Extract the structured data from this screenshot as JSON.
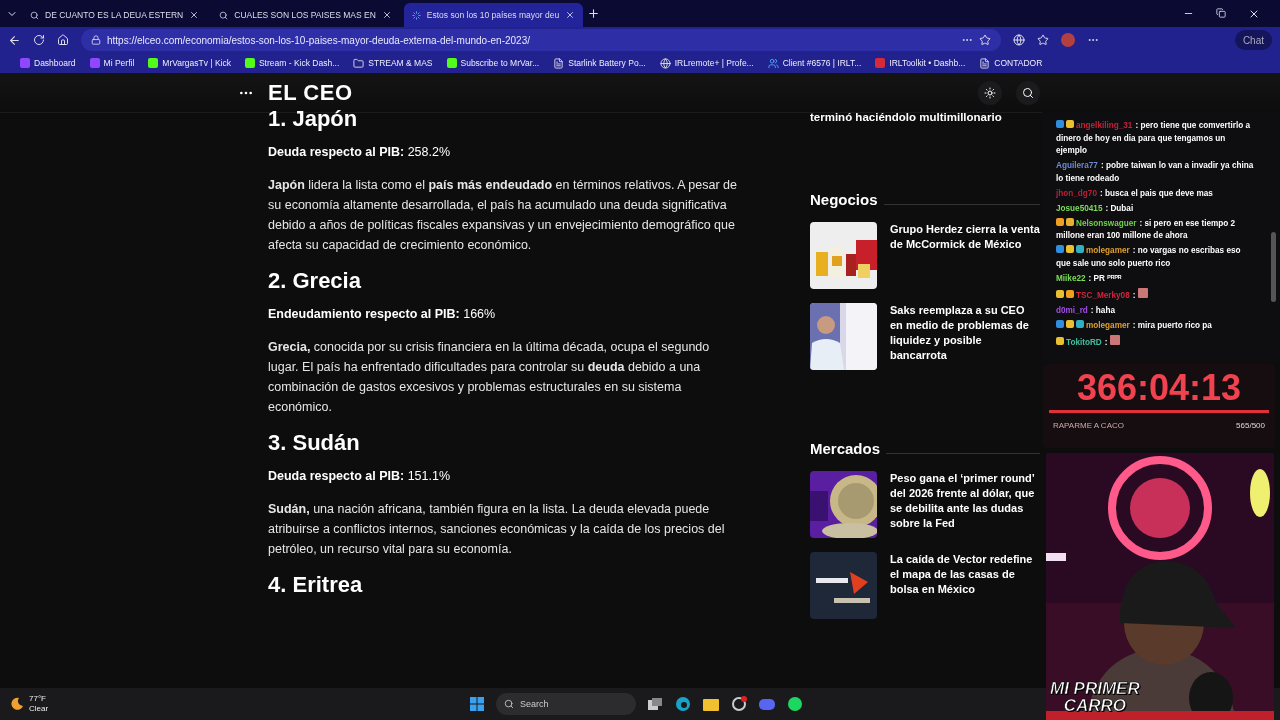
{
  "browser": {
    "tabs": [
      {
        "title": "DE CUANTO ES LA DEUA ESTERN",
        "kind": "search",
        "selected": false
      },
      {
        "title": "CUALES SON LOS PAISES MAS EN",
        "kind": "search",
        "selected": false
      },
      {
        "title": "Estos son los 10 países mayor deu",
        "kind": "loading",
        "selected": true
      }
    ],
    "url": "https://elceo.com/economia/estos-son-los-10-paises-mayor-deuda-externa-del-mundo-en-2023/",
    "chat_button": "Chat",
    "bookmarks": [
      {
        "label": "Dashboard",
        "kind": "twitch"
      },
      {
        "label": "Mi Perfil",
        "kind": "twitch"
      },
      {
        "label": "MrVargasTv | Kick",
        "kind": "kick"
      },
      {
        "label": "Stream - Kick Dash...",
        "kind": "kick"
      },
      {
        "label": "STREAM & MAS",
        "kind": "folder"
      },
      {
        "label": "Subscribe to MrVar...",
        "kind": "kick"
      },
      {
        "label": "Starlink Battery Po...",
        "kind": "page"
      },
      {
        "label": "IRLremote+ | Profe...",
        "kind": "globe"
      },
      {
        "label": "Client #6576 | IRLT...",
        "kind": "people"
      },
      {
        "label": "IRLToolkit • Dashb...",
        "kind": "toolkit"
      },
      {
        "label": "CONTADOR",
        "kind": "page"
      }
    ]
  },
  "site": {
    "logo": "EL CEO"
  },
  "article": {
    "sections": [
      {
        "heading": "1. Japón",
        "stat": "**Deuda respecto al PIB:** 258.2%",
        "paragraph": "**Japón** lidera la lista como el **país más endeudado** en términos relativos. A pesar de su economía altamente desarrollada, el país ha acumulado una deuda significativa debido a años de políticas fiscales expansivas y un envejecimiento demográfico que afecta su capacidad de crecimiento económico."
      },
      {
        "heading": "2. Grecia",
        "stat": "**Endeudamiento respecto al PIB:** 166%",
        "paragraph": "**Grecia,** conocida por su crisis financiera en la última década, ocupa el segundo lugar. El país ha enfrentado dificultades para controlar su **deuda** debido a una combinación de gastos excesivos y problemas estructurales en su sistema económico."
      },
      {
        "heading": "3. Sudán",
        "stat": "**Deuda respecto al PIB:** 151.1%",
        "paragraph": "**Sudán,** una nación africana, también figura en la lista. La deuda elevada puede atribuirse a conflictos internos, sanciones económicas y la caída de los precios del petróleo, un recurso vital para su economía."
      },
      {
        "heading": "4. Eritrea"
      }
    ]
  },
  "sidebar": {
    "top_headline": "terminó haciéndolo multimillonario",
    "categories": [
      {
        "title": "Negocios",
        "articles": [
          {
            "headline": "Grupo Herdez cierra la venta de McCormick de México",
            "kind": "picture"
          },
          {
            "headline": "Saks reemplaza a su CEO en medio de problemas de liquidez y posible bancarrota",
            "kind": "picture"
          }
        ]
      },
      {
        "title": "Mercados",
        "articles": [
          {
            "headline": "Peso gana el ‘primer round’ del 2026 frente al dólar, que se debilita ante las dudas sobre la Fed",
            "kind": "picture"
          },
          {
            "headline": "La caída de Vector redefine el mapa de las casas de bolsa en México",
            "kind": "picture"
          }
        ]
      }
    ]
  },
  "chat": {
    "messages": [
      {
        "user": "angelkiling_31",
        "color": "#c0223a",
        "badges": [
          {
            "color": "#2f8ee0"
          },
          {
            "color": "#e8c030"
          }
        ],
        "kind": "text",
        "text": ": pero tiene que comvertirlo a dinero de hoy en dia para que tengamos un ejemplo"
      },
      {
        "user": "Aguilera77",
        "color": "#6b8bd6",
        "kind": "text",
        "text": ": pobre taiwan lo van a invadir ya china lo tiene rodeado"
      },
      {
        "user": "jhon_dg70",
        "color": "#b8203a",
        "kind": "text",
        "text": ": busca el pais que deve mas"
      },
      {
        "user": "Josue50415",
        "color": "#7ddc5a",
        "kind": "text",
        "text": ": Dubai"
      },
      {
        "user": "Nelsonswaguer",
        "color": "#6fd14a",
        "badges": [
          {
            "color": "#f0a020"
          },
          {
            "color": "#e8b030"
          }
        ],
        "kind": "text",
        "text": ": si pero en ese tiempo 2 millone eran 100 millone de ahora"
      },
      {
        "user": "molegamer",
        "color": "#e0a030",
        "badges": [
          {
            "color": "#2f8ee0"
          },
          {
            "color": "#e8c030"
          },
          {
            "color": "#30b0c0"
          }
        ],
        "kind": "text",
        "text": ": no vargas no escribas eso que sale uno solo puerto rico"
      },
      {
        "user": "Miike22",
        "color": "#7ddc5a",
        "kind": "text",
        "text": ": PR ᴾᴿᴾᴿ"
      },
      {
        "user": "TSC_Merky08",
        "color": "#d0243c",
        "badges": [
          {
            "color": "#e8c030"
          },
          {
            "color": "#f0a020"
          }
        ],
        "kind": "emote",
        "text": ":"
      },
      {
        "user": "d0mi_rd",
        "color": "#a050e0",
        "kind": "text",
        "text": ": haha"
      },
      {
        "user": "molegamer",
        "color": "#e0a030",
        "badges": [
          {
            "color": "#2f8ee0"
          },
          {
            "color": "#e8c030"
          },
          {
            "color": "#30b0c0"
          }
        ],
        "kind": "text",
        "text": ": mira puerto rico pa"
      },
      {
        "user": "TokitoRD",
        "color": "#40c0a0",
        "badges": [
          {
            "color": "#e8c030"
          }
        ],
        "kind": "emote",
        "text": ":"
      }
    ]
  },
  "timer": {
    "value": "366:04:13",
    "goal_label": "RAPARME A CACO",
    "goal_count": "565/500",
    "level": 1
  },
  "webcam": {
    "kind": "picture",
    "caption": [
      "MI PRIMER",
      "CARRO"
    ]
  },
  "taskbar": {
    "temperature": "77°F",
    "condition": "Clear",
    "search_placeholder": "Search"
  }
}
